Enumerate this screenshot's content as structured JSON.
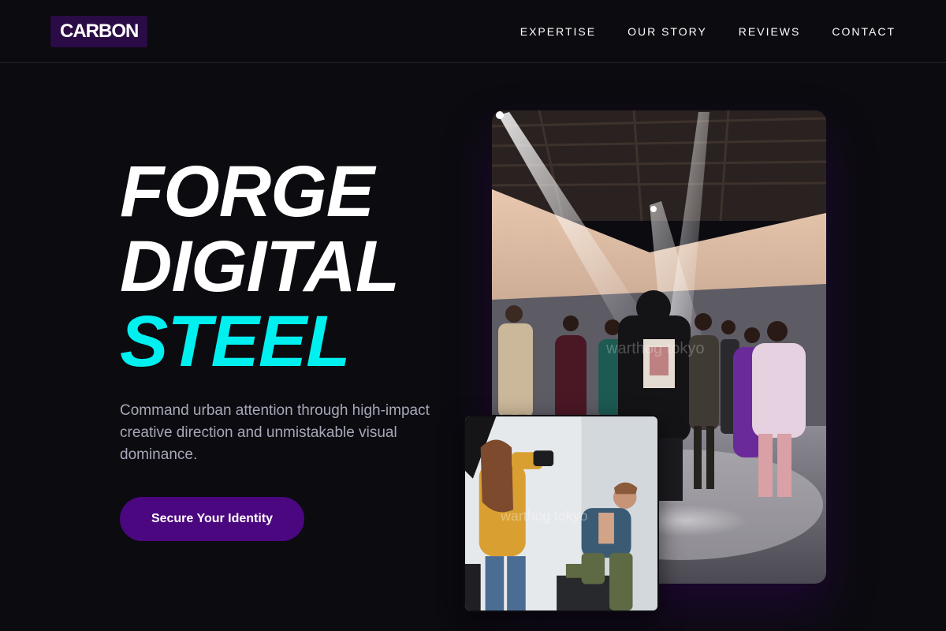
{
  "header": {
    "logo": "CARBON",
    "nav": [
      "EXPERTISE",
      "OUR STORY",
      "REVIEWS",
      "CONTACT"
    ]
  },
  "hero": {
    "title_lines": [
      "FORGE",
      "DIGITAL",
      "STEEL"
    ],
    "subtitle": "Command urban attention through high-impact creative direction and unmistakable visual dominance.",
    "cta_label": "Secure Your Identity"
  },
  "images": {
    "main": {
      "description_icon": "fashion-runway-photo",
      "watermark": "warthog tokyo"
    },
    "secondary": {
      "description_icon": "photoshoot-studio-photo",
      "watermark": "warthog tokyo"
    }
  },
  "colors": {
    "background": "#0c0b10",
    "accent_cyan": "#00f0f0",
    "accent_purple": "#4b077f",
    "logo_bg": "#2a0b45",
    "subtitle_gray": "#a6a8b8"
  }
}
